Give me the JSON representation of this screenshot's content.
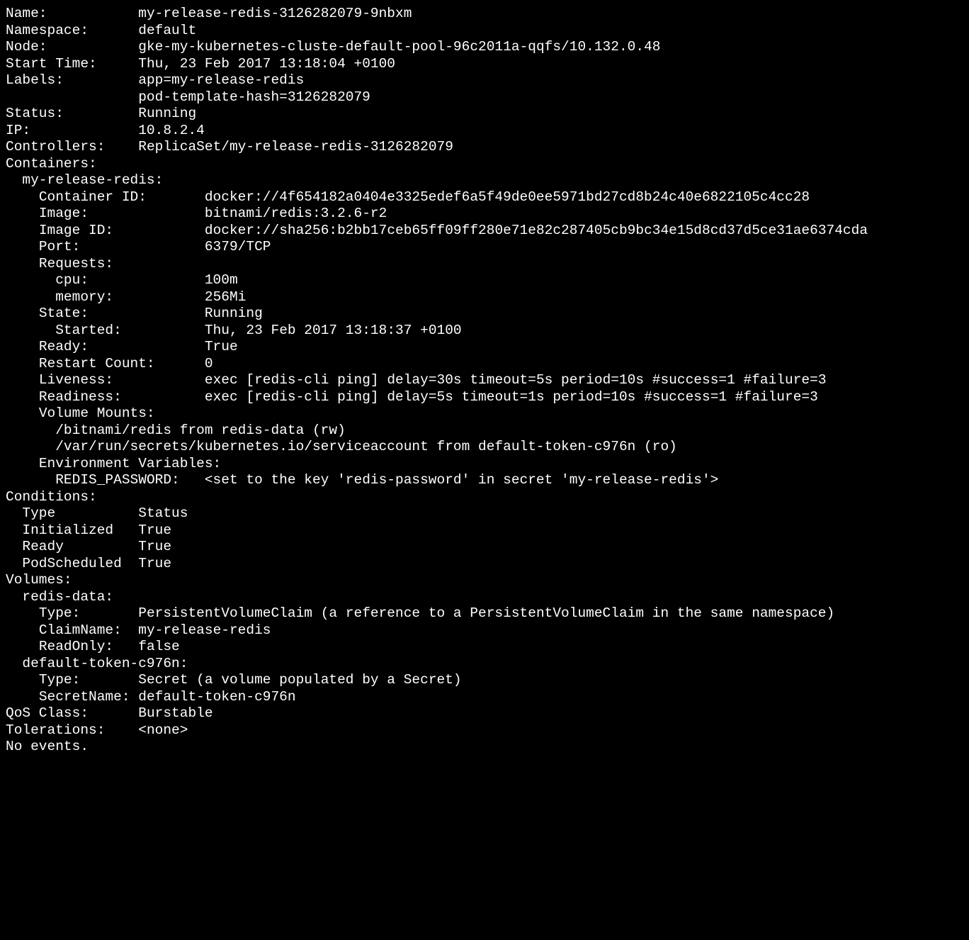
{
  "pod": {
    "name_label": "Name:",
    "name": "my-release-redis-3126282079-9nbxm",
    "namespace_label": "Namespace:",
    "namespace": "default",
    "node_label": "Node:",
    "node": "gke-my-kubernetes-cluste-default-pool-96c2011a-qqfs/10.132.0.48",
    "start_time_label": "Start Time:",
    "start_time": "Thu, 23 Feb 2017 13:18:04 +0100",
    "labels_label": "Labels:",
    "labels": [
      "app=my-release-redis",
      "pod-template-hash=3126282079"
    ],
    "status_label": "Status:",
    "status": "Running",
    "ip_label": "IP:",
    "ip": "10.8.2.4",
    "controllers_label": "Controllers:",
    "controllers": "ReplicaSet/my-release-redis-3126282079",
    "containers_label": "Containers:",
    "container": {
      "name": "my-release-redis:",
      "container_id_label": "Container ID:",
      "container_id": "docker://4f654182a0404e3325edef6a5f49de0ee5971bd27cd8b24c40e6822105c4cc28",
      "image_label": "Image:",
      "image": "bitnami/redis:3.2.6-r2",
      "image_id_label": "Image ID:",
      "image_id": "docker://sha256:b2bb17ceb65ff09ff280e71e82c287405cb9bc34e15d8cd37d5ce31ae6374cda",
      "port_label": "Port:",
      "port": "6379/TCP",
      "requests_label": "Requests:",
      "requests": {
        "cpu_label": "cpu:",
        "cpu": "100m",
        "memory_label": "memory:",
        "memory": "256Mi"
      },
      "state_label": "State:",
      "state": "Running",
      "started_label": "Started:",
      "started": "Thu, 23 Feb 2017 13:18:37 +0100",
      "ready_label": "Ready:",
      "ready": "True",
      "restart_count_label": "Restart Count:",
      "restart_count": "0",
      "liveness_label": "Liveness:",
      "liveness": "exec [redis-cli ping] delay=30s timeout=5s period=10s #success=1 #failure=3",
      "readiness_label": "Readiness:",
      "readiness": "exec [redis-cli ping] delay=5s timeout=1s period=10s #success=1 #failure=3",
      "volume_mounts_label": "Volume Mounts:",
      "volume_mounts": [
        "/bitnami/redis from redis-data (rw)",
        "/var/run/secrets/kubernetes.io/serviceaccount from default-token-c976n (ro)"
      ],
      "env_vars_label": "Environment Variables:",
      "env_vars": {
        "redis_password_label": "REDIS_PASSWORD:",
        "redis_password": "<set to the key 'redis-password' in secret 'my-release-redis'>"
      }
    },
    "conditions_label": "Conditions:",
    "conditions": {
      "header_type": "Type",
      "header_status": "Status",
      "rows": [
        {
          "type": "Initialized",
          "status": "True"
        },
        {
          "type": "Ready",
          "status": "True"
        },
        {
          "type": "PodScheduled",
          "status": "True"
        }
      ]
    },
    "volumes_label": "Volumes:",
    "volumes": {
      "redis_data": {
        "name": "redis-data:",
        "type_label": "Type:",
        "type": "PersistentVolumeClaim (a reference to a PersistentVolumeClaim in the same namespace)",
        "claim_name_label": "ClaimName:",
        "claim_name": "my-release-redis",
        "read_only_label": "ReadOnly:",
        "read_only": "false"
      },
      "default_token": {
        "name": "default-token-c976n:",
        "type_label": "Type:",
        "type": "Secret (a volume populated by a Secret)",
        "secret_name_label": "SecretName:",
        "secret_name": "default-token-c976n"
      }
    },
    "qos_class_label": "QoS Class:",
    "qos_class": "Burstable",
    "tolerations_label": "Tolerations:",
    "tolerations": "<none>",
    "no_events": "No events."
  }
}
